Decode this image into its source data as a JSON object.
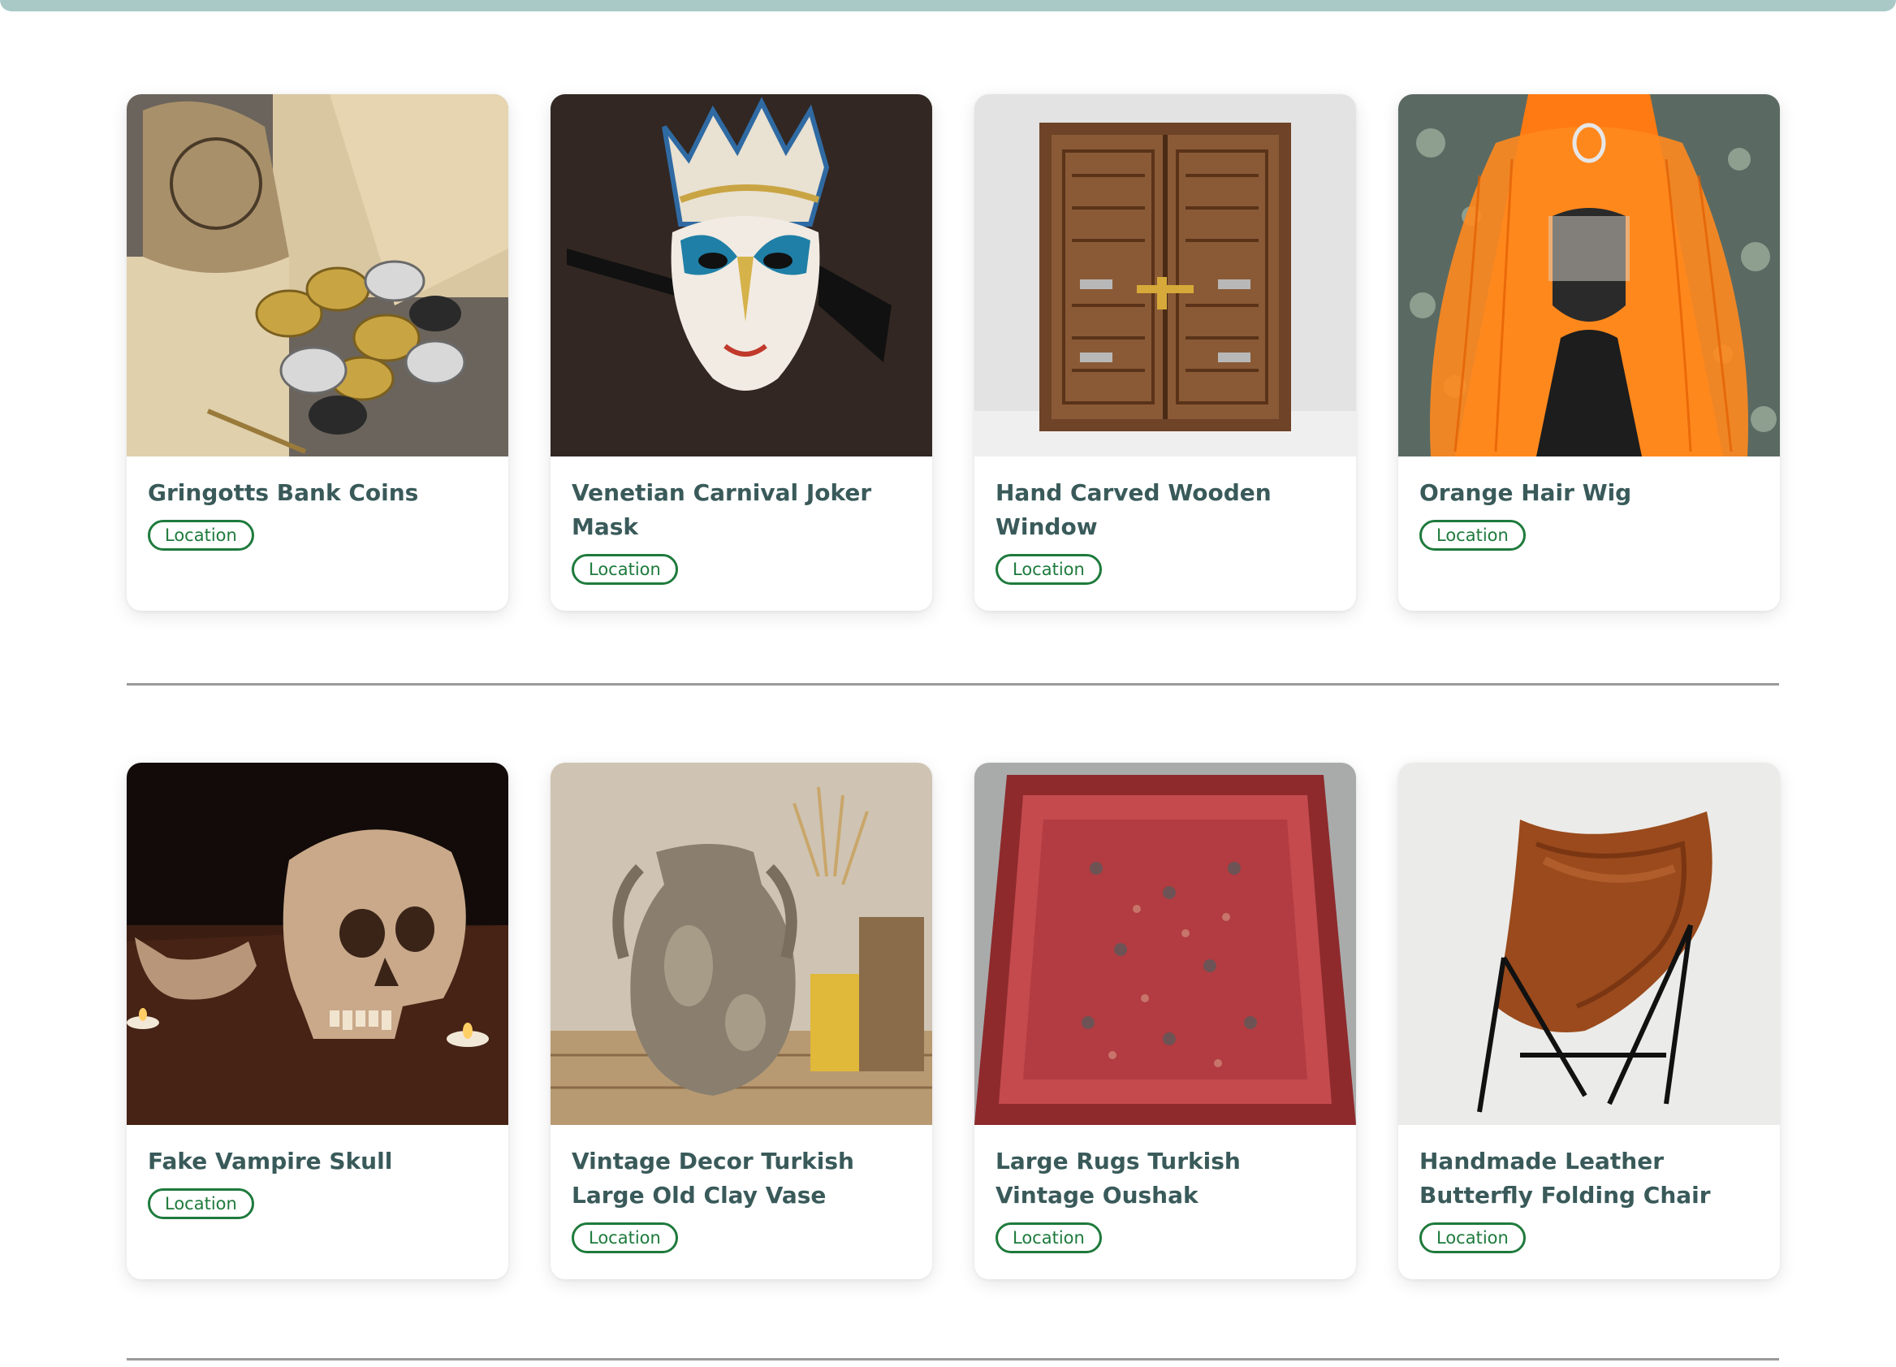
{
  "colors": {
    "top_bar": "#a9c9c6",
    "title_text": "#3a5a5a",
    "location_badge": "#1e7a3c",
    "divider": "#9a9a9a"
  },
  "rows": [
    {
      "items": [
        {
          "title": "Gringotts Bank Coins",
          "badge": "Location",
          "image": "coins-pouch-map-photo"
        },
        {
          "title": "Venetian Carnival Joker Mask",
          "badge": "Location",
          "image": "jester-mask-photo"
        },
        {
          "title": "Hand Carved Wooden Window",
          "badge": "Location",
          "image": "carved-wooden-window-photo"
        },
        {
          "title": "Orange Hair Wig",
          "badge": "Location",
          "image": "orange-wig-photo"
        }
      ]
    },
    {
      "items": [
        {
          "title": "Fake Vampire Skull",
          "badge": "Location",
          "image": "vampire-skull-photo"
        },
        {
          "title": "Vintage Decor Turkish Large Old Clay Vase",
          "badge": "Location",
          "image": "clay-vase-photo"
        },
        {
          "title": "Large Rugs Turkish Vintage Oushak",
          "badge": "Location",
          "image": "red-rug-photo"
        },
        {
          "title": "Handmade Leather Butterfly Folding Chair",
          "badge": "Location",
          "image": "leather-chair-photo"
        }
      ]
    }
  ]
}
